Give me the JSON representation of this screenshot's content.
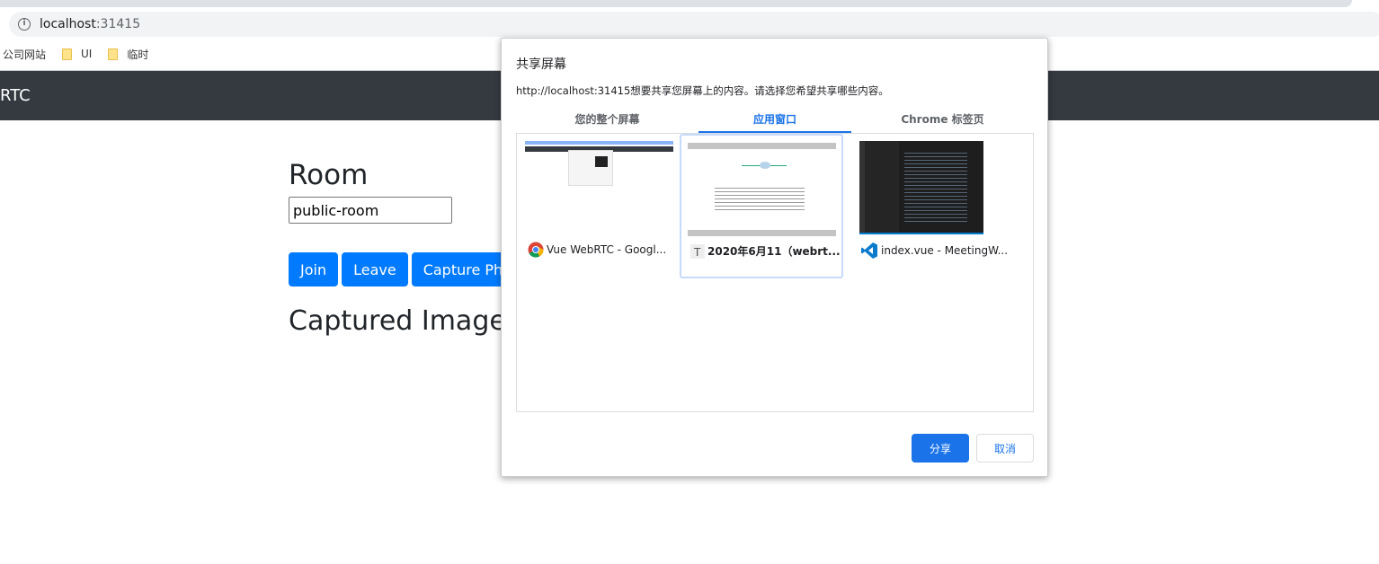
{
  "browser": {
    "url_host": "localhost",
    "url_port": ":31415",
    "bookmarks": [
      {
        "label": "公司网站"
      },
      {
        "label": "UI"
      },
      {
        "label": "临时"
      }
    ]
  },
  "navbar": {
    "title": "RTC"
  },
  "main": {
    "room_heading": "Room",
    "room_value": "public-room",
    "buttons": {
      "join": "Join",
      "leave": "Leave",
      "capture": "Capture Phot"
    },
    "captured_heading": "Captured Image"
  },
  "dialog": {
    "title": "共享屏幕",
    "description": "http://localhost:31415想要共享您屏幕上的内容。请选择您希望共享哪些内容。",
    "tabs": [
      {
        "label": "您的整个屏幕"
      },
      {
        "label": "应用窗口",
        "active": true
      },
      {
        "label": "Chrome 标签页"
      }
    ],
    "windows": [
      {
        "label": "Vue WebRTC - Googl...",
        "icon": "chrome-icon"
      },
      {
        "label": "2020年6月11（webrt...",
        "icon": "typora-icon",
        "selected": true
      },
      {
        "label": "index.vue - MeetingW...",
        "icon": "vscode-icon"
      }
    ],
    "share": "分享",
    "cancel": "取消",
    "colors": {
      "accent": "#1a73e8",
      "button": "#007bff",
      "navbar": "#343a40"
    }
  }
}
